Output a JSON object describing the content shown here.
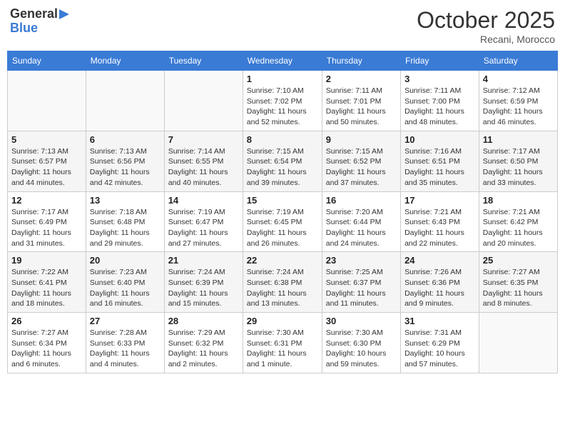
{
  "header": {
    "logo_general": "General",
    "logo_blue": "Blue",
    "month_title": "October 2025",
    "location": "Recani, Morocco"
  },
  "days_of_week": [
    "Sunday",
    "Monday",
    "Tuesday",
    "Wednesday",
    "Thursday",
    "Friday",
    "Saturday"
  ],
  "weeks": [
    [
      {
        "day": "",
        "info": ""
      },
      {
        "day": "",
        "info": ""
      },
      {
        "day": "",
        "info": ""
      },
      {
        "day": "1",
        "info": "Sunrise: 7:10 AM\nSunset: 7:02 PM\nDaylight: 11 hours and 52 minutes."
      },
      {
        "day": "2",
        "info": "Sunrise: 7:11 AM\nSunset: 7:01 PM\nDaylight: 11 hours and 50 minutes."
      },
      {
        "day": "3",
        "info": "Sunrise: 7:11 AM\nSunset: 7:00 PM\nDaylight: 11 hours and 48 minutes."
      },
      {
        "day": "4",
        "info": "Sunrise: 7:12 AM\nSunset: 6:59 PM\nDaylight: 11 hours and 46 minutes."
      }
    ],
    [
      {
        "day": "5",
        "info": "Sunrise: 7:13 AM\nSunset: 6:57 PM\nDaylight: 11 hours and 44 minutes."
      },
      {
        "day": "6",
        "info": "Sunrise: 7:13 AM\nSunset: 6:56 PM\nDaylight: 11 hours and 42 minutes."
      },
      {
        "day": "7",
        "info": "Sunrise: 7:14 AM\nSunset: 6:55 PM\nDaylight: 11 hours and 40 minutes."
      },
      {
        "day": "8",
        "info": "Sunrise: 7:15 AM\nSunset: 6:54 PM\nDaylight: 11 hours and 39 minutes."
      },
      {
        "day": "9",
        "info": "Sunrise: 7:15 AM\nSunset: 6:52 PM\nDaylight: 11 hours and 37 minutes."
      },
      {
        "day": "10",
        "info": "Sunrise: 7:16 AM\nSunset: 6:51 PM\nDaylight: 11 hours and 35 minutes."
      },
      {
        "day": "11",
        "info": "Sunrise: 7:17 AM\nSunset: 6:50 PM\nDaylight: 11 hours and 33 minutes."
      }
    ],
    [
      {
        "day": "12",
        "info": "Sunrise: 7:17 AM\nSunset: 6:49 PM\nDaylight: 11 hours and 31 minutes."
      },
      {
        "day": "13",
        "info": "Sunrise: 7:18 AM\nSunset: 6:48 PM\nDaylight: 11 hours and 29 minutes."
      },
      {
        "day": "14",
        "info": "Sunrise: 7:19 AM\nSunset: 6:47 PM\nDaylight: 11 hours and 27 minutes."
      },
      {
        "day": "15",
        "info": "Sunrise: 7:19 AM\nSunset: 6:45 PM\nDaylight: 11 hours and 26 minutes."
      },
      {
        "day": "16",
        "info": "Sunrise: 7:20 AM\nSunset: 6:44 PM\nDaylight: 11 hours and 24 minutes."
      },
      {
        "day": "17",
        "info": "Sunrise: 7:21 AM\nSunset: 6:43 PM\nDaylight: 11 hours and 22 minutes."
      },
      {
        "day": "18",
        "info": "Sunrise: 7:21 AM\nSunset: 6:42 PM\nDaylight: 11 hours and 20 minutes."
      }
    ],
    [
      {
        "day": "19",
        "info": "Sunrise: 7:22 AM\nSunset: 6:41 PM\nDaylight: 11 hours and 18 minutes."
      },
      {
        "day": "20",
        "info": "Sunrise: 7:23 AM\nSunset: 6:40 PM\nDaylight: 11 hours and 16 minutes."
      },
      {
        "day": "21",
        "info": "Sunrise: 7:24 AM\nSunset: 6:39 PM\nDaylight: 11 hours and 15 minutes."
      },
      {
        "day": "22",
        "info": "Sunrise: 7:24 AM\nSunset: 6:38 PM\nDaylight: 11 hours and 13 minutes."
      },
      {
        "day": "23",
        "info": "Sunrise: 7:25 AM\nSunset: 6:37 PM\nDaylight: 11 hours and 11 minutes."
      },
      {
        "day": "24",
        "info": "Sunrise: 7:26 AM\nSunset: 6:36 PM\nDaylight: 11 hours and 9 minutes."
      },
      {
        "day": "25",
        "info": "Sunrise: 7:27 AM\nSunset: 6:35 PM\nDaylight: 11 hours and 8 minutes."
      }
    ],
    [
      {
        "day": "26",
        "info": "Sunrise: 7:27 AM\nSunset: 6:34 PM\nDaylight: 11 hours and 6 minutes."
      },
      {
        "day": "27",
        "info": "Sunrise: 7:28 AM\nSunset: 6:33 PM\nDaylight: 11 hours and 4 minutes."
      },
      {
        "day": "28",
        "info": "Sunrise: 7:29 AM\nSunset: 6:32 PM\nDaylight: 11 hours and 2 minutes."
      },
      {
        "day": "29",
        "info": "Sunrise: 7:30 AM\nSunset: 6:31 PM\nDaylight: 11 hours and 1 minute."
      },
      {
        "day": "30",
        "info": "Sunrise: 7:30 AM\nSunset: 6:30 PM\nDaylight: 10 hours and 59 minutes."
      },
      {
        "day": "31",
        "info": "Sunrise: 7:31 AM\nSunset: 6:29 PM\nDaylight: 10 hours and 57 minutes."
      },
      {
        "day": "",
        "info": ""
      }
    ]
  ]
}
